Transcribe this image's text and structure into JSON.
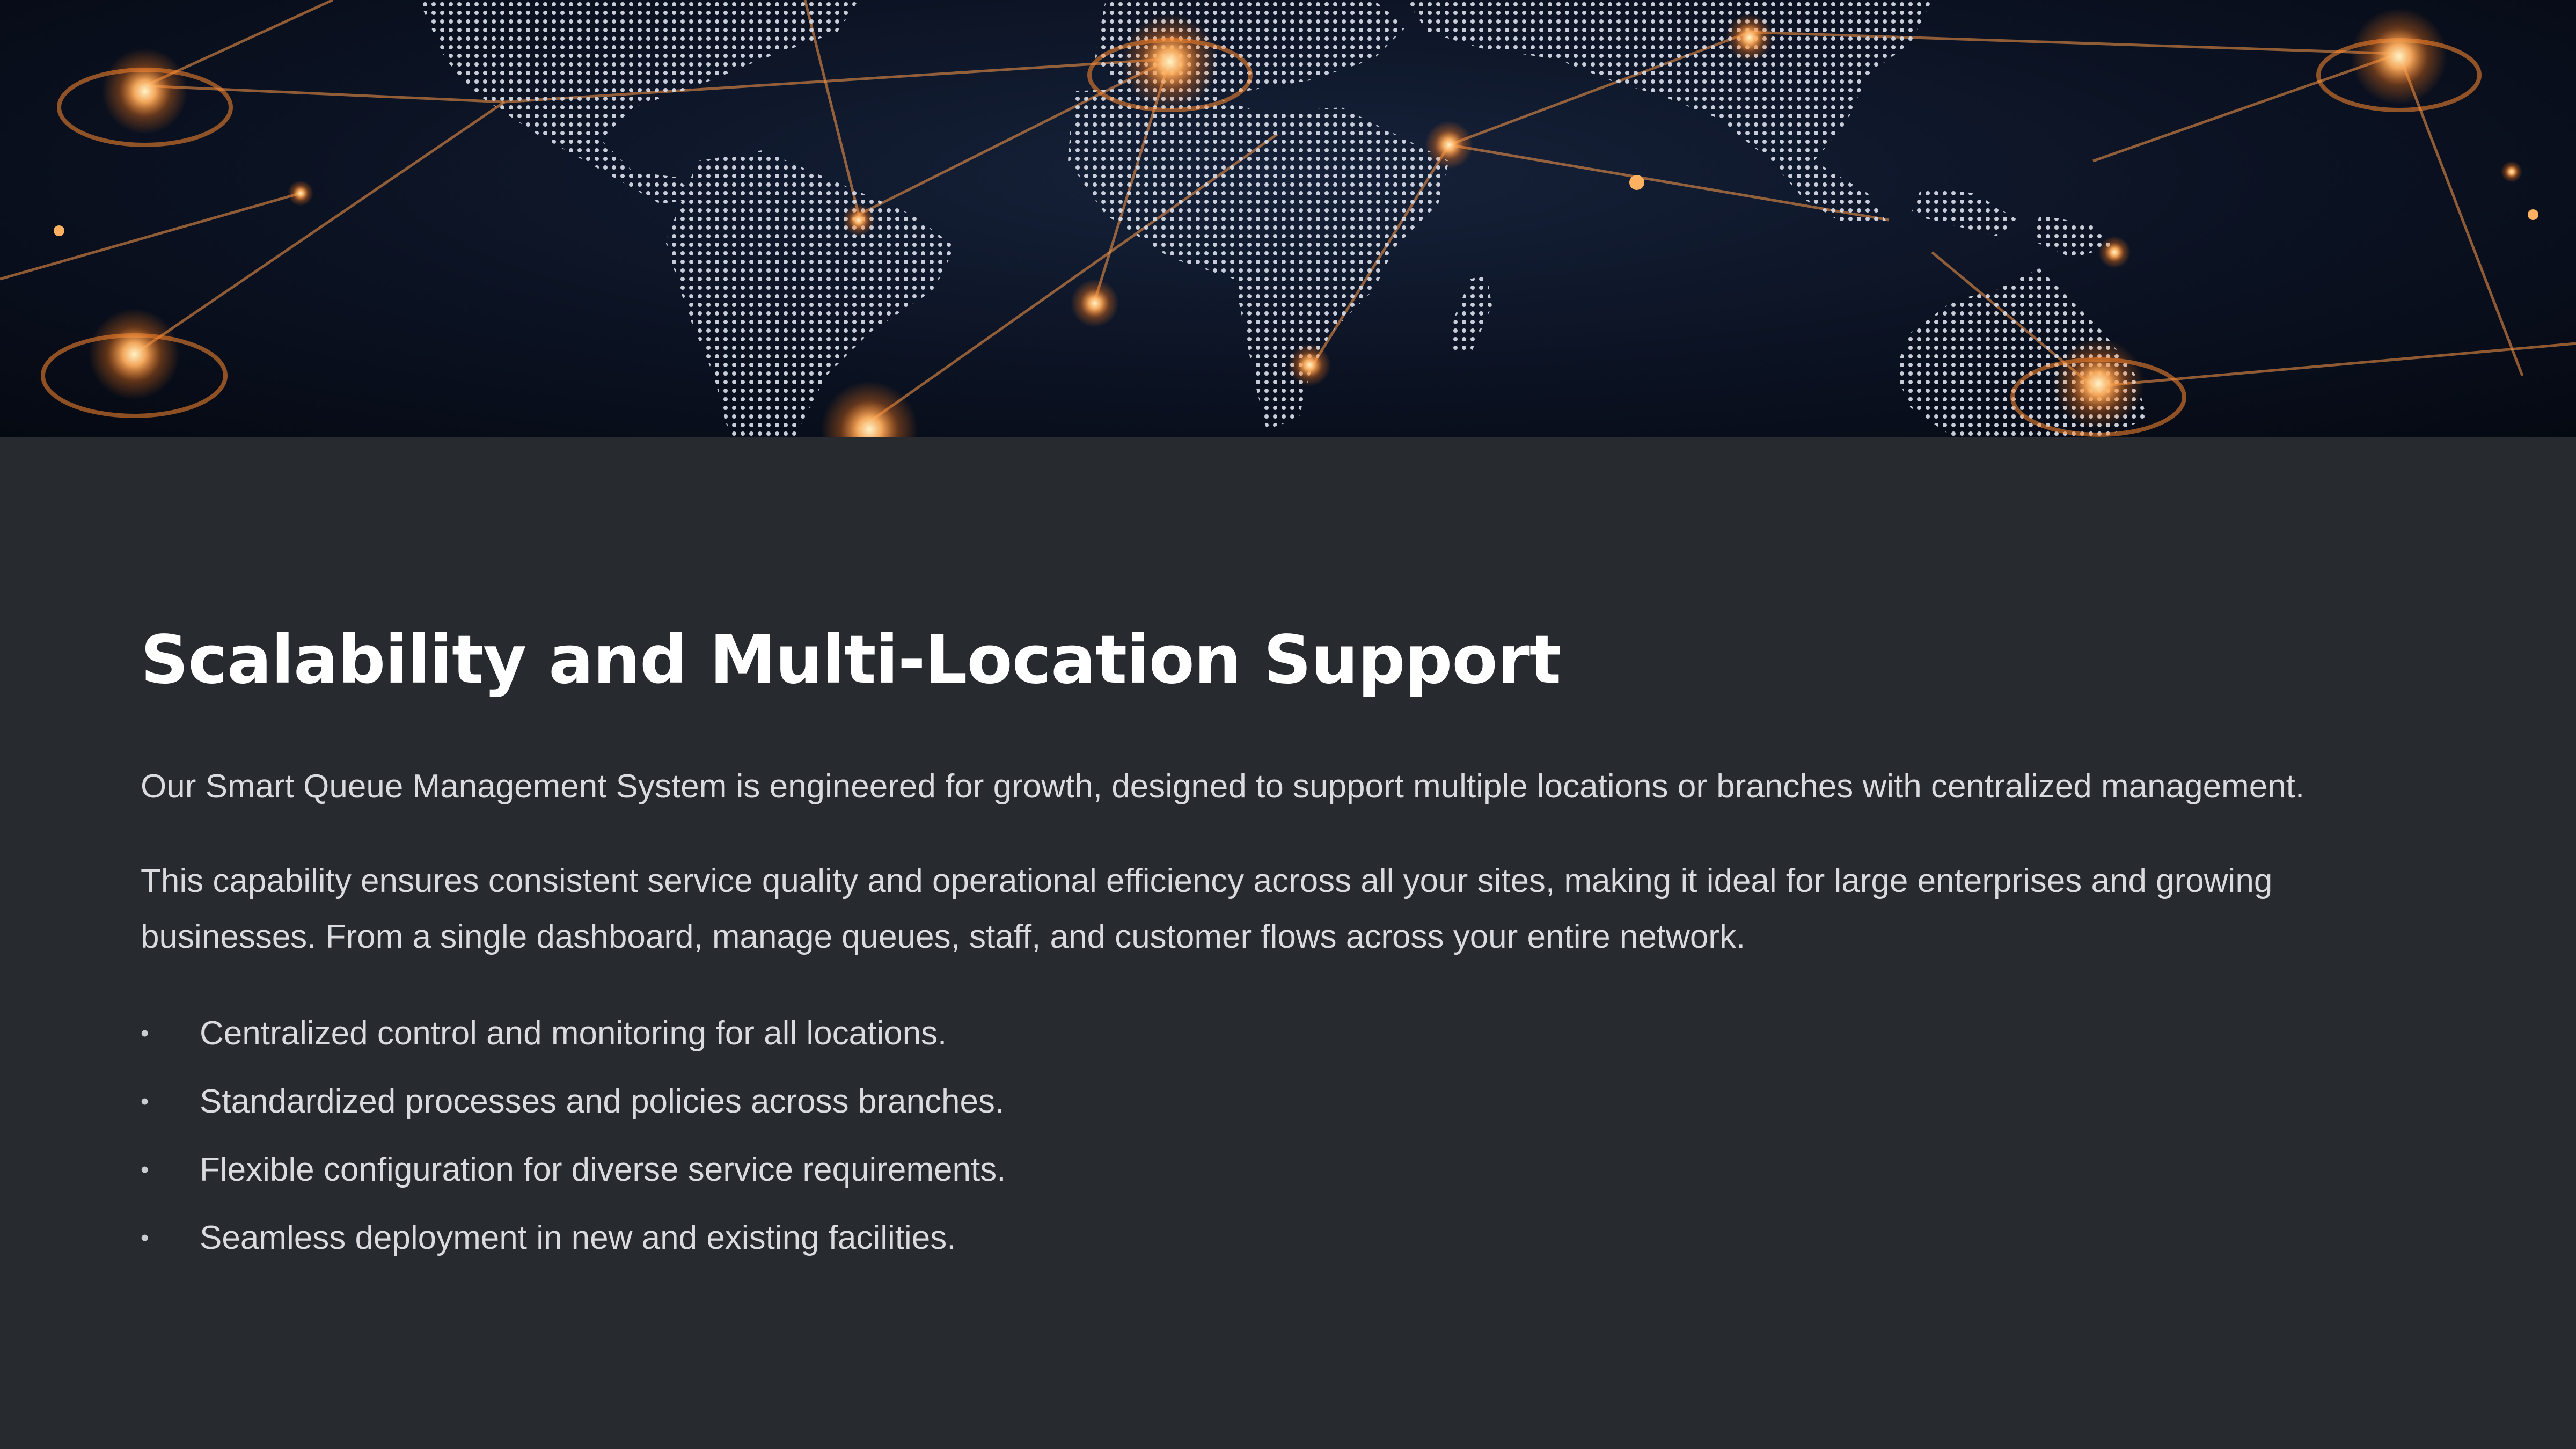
{
  "hero": {
    "image": "world-network-map"
  },
  "heading": {
    "title": "Scalability and Multi-Location Support"
  },
  "paragraphs": [
    "Our Smart Queue Management System is engineered for growth, designed to support multiple locations or branches with centralized management.",
    "This capability ensures consistent service quality and operational efficiency across all your sites, making it ideal for large enterprises and growing businesses. From a single dashboard, manage queues, staff, and customer flows across your entire network."
  ],
  "bullets": [
    "Centralized control and monitoring for all locations.",
    "Standardized processes and policies across branches.",
    "Flexible configuration for diverse service requirements.",
    "Seamless deployment in new and existing facilities."
  ],
  "bullet_marker": "•",
  "colors": {
    "background": "#272a2e",
    "title": "#ffffff",
    "body_text": "#d9dbdf",
    "glow": "#ffb060"
  }
}
